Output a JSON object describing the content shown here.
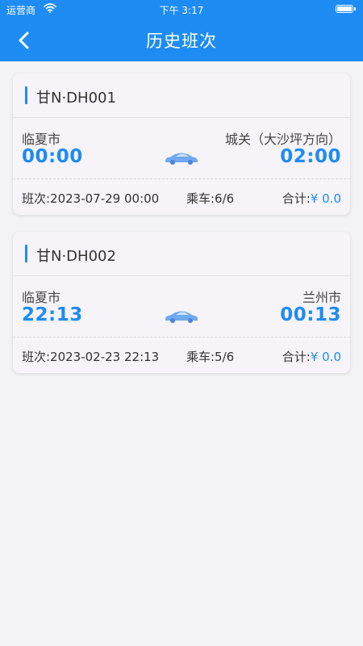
{
  "status_bar": {
    "carrier": "运营商",
    "time": "下午 3:17"
  },
  "nav": {
    "title": "历史班次",
    "back_icon": "chevron-left-icon"
  },
  "colors": {
    "primary": "#1e8cf3",
    "card_bg": "#f6f3f9",
    "page_bg": "#f3f3f5"
  },
  "trips": [
    {
      "plate": "甘N·DH001",
      "from": "临夏市",
      "from_time": "00:00",
      "to": "城关（大沙坪方向）",
      "to_time": "02:00",
      "schedule": "班次:2023-07-29 00:00",
      "seats": "乘车:6/6",
      "total_label": "合计:",
      "total_value": "¥ 0.0"
    },
    {
      "plate": "甘N·DH002",
      "from": "临夏市",
      "from_time": "22:13",
      "to": "兰州市",
      "to_time": "00:13",
      "schedule": "班次:2023-02-23 22:13",
      "seats": "乘车:5/6",
      "total_label": "合计:",
      "total_value": "¥ 0.0"
    }
  ]
}
